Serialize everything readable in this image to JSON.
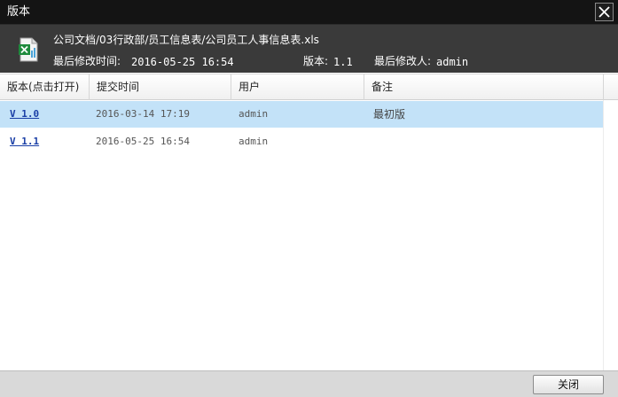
{
  "window": {
    "title": "版本"
  },
  "file": {
    "path": "公司文档/03行政部/员工信息表/公司员工人事信息表.xls",
    "last_modified_label": "最后修改时间:",
    "last_modified_value": "2016-05-25 16:54",
    "version_label": "版本:",
    "version_value": "1.1",
    "modifier_label": "最后修改人:",
    "modifier_value": "admin",
    "icon": "excel-file-icon"
  },
  "table": {
    "columns": [
      "版本(点击打开)",
      "提交时间",
      "用户",
      "备注"
    ],
    "rows": [
      {
        "version": "V 1.0",
        "time": "2016-03-14 17:19",
        "user": "admin",
        "note": "最初版"
      },
      {
        "version": "V 1.1",
        "time": "2016-05-25 16:54",
        "user": "admin",
        "note": ""
      }
    ]
  },
  "footer": {
    "close_label": "关闭"
  },
  "colors": {
    "titlebar": "#141414",
    "info_panel": "#3a3a3a",
    "selected_row": "#c3e2f8",
    "link": "#1a3fa6"
  }
}
